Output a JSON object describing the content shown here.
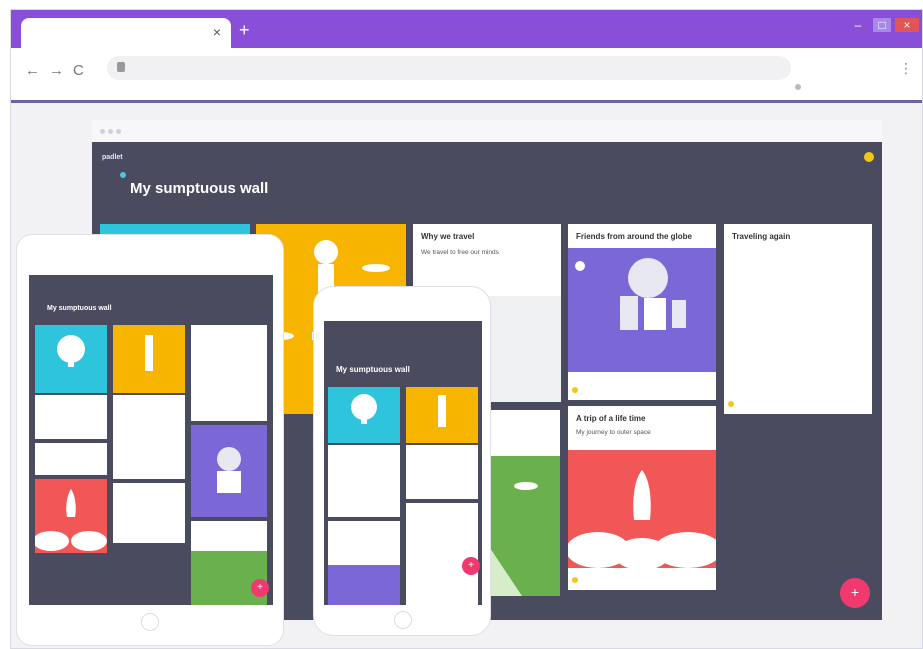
{
  "browser": {
    "tab_close": "×",
    "new_tab": "+",
    "nav": {
      "back": "←",
      "forward": "→",
      "reload": "C"
    },
    "menu_glyph": "⋮",
    "window": {
      "minimize": "–",
      "maximize": "□",
      "close": "×"
    },
    "colors": {
      "titlebar": "#8a4fd8",
      "accent": "#f0396f"
    }
  },
  "wall": {
    "logo": "padlet",
    "title": "My sumptuous wall",
    "fab": "+",
    "cards": {
      "why_we_travel": {
        "title": "Why we travel",
        "text": "We travel to free our minds"
      },
      "friends_around_globe": {
        "title": "Friends from around the globe"
      },
      "traveling_again": {
        "title": "Traveling again"
      },
      "trip_of_lifetime": {
        "title": "A trip of a life time",
        "text": "My journey to outer space"
      }
    }
  },
  "tablet": {
    "title": "My sumptuous wall"
  },
  "phone": {
    "title": "My sumptuous wall"
  }
}
